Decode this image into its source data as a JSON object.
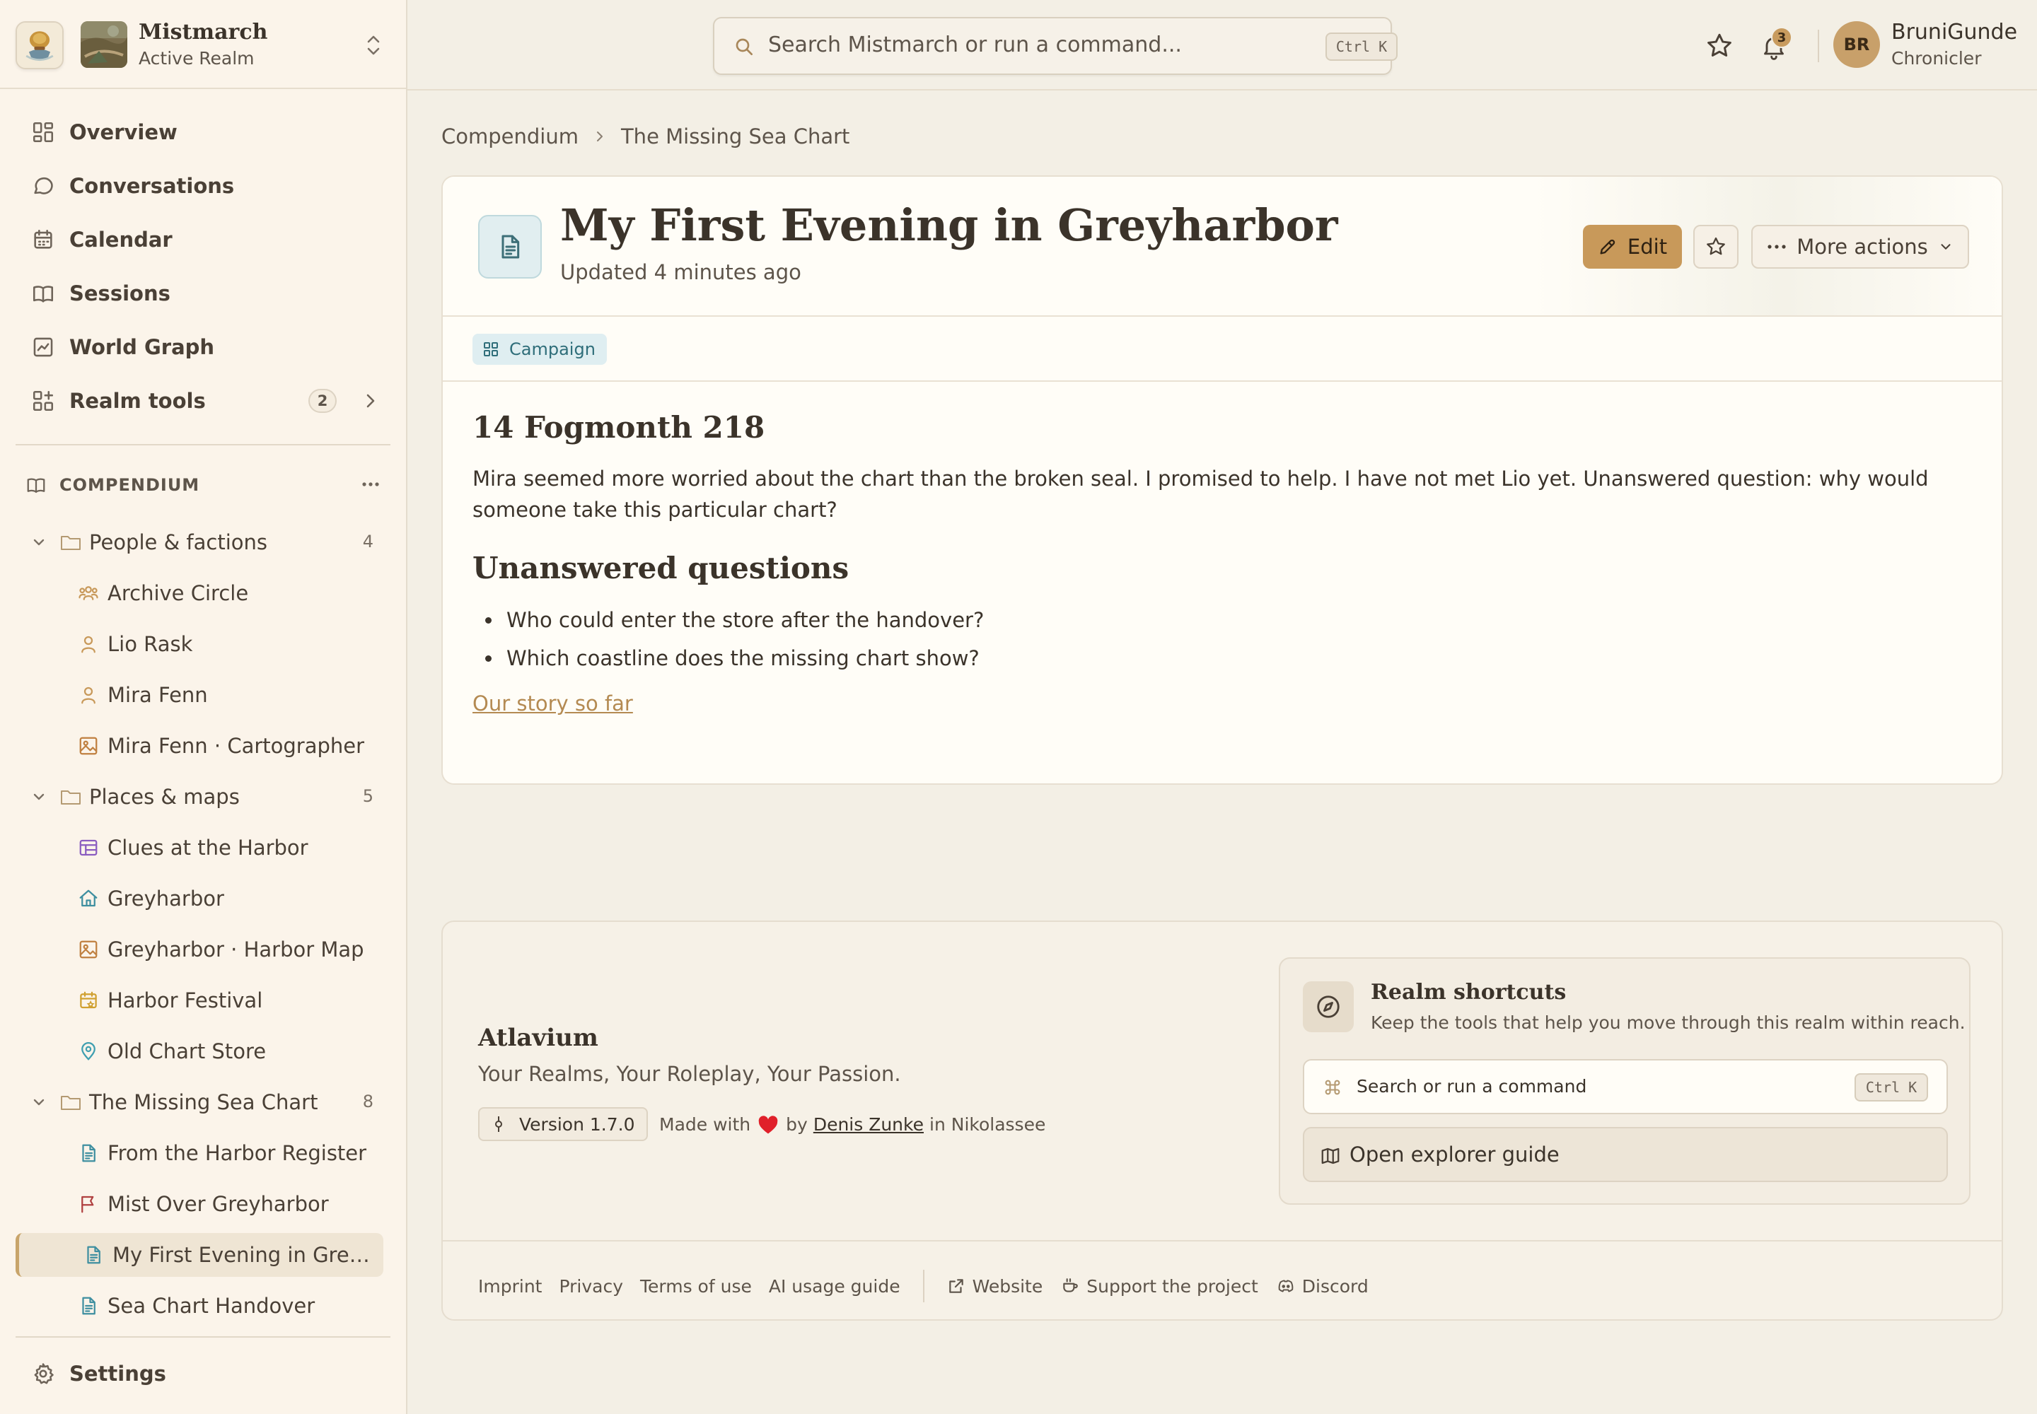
{
  "app": {
    "name": "Mistmarch",
    "realm_status": "Active Realm"
  },
  "nav": {
    "items": [
      {
        "label": "Overview",
        "icon": "dashboard-icon"
      },
      {
        "label": "Conversations",
        "icon": "chat-bubble-icon"
      },
      {
        "label": "Calendar",
        "icon": "calendar-icon"
      },
      {
        "label": "Sessions",
        "icon": "book-open-icon"
      },
      {
        "label": "World Graph",
        "icon": "line-chart-icon"
      },
      {
        "label": "Realm tools",
        "icon": "grid-plus-icon",
        "badge": "2"
      }
    ],
    "settings_label": "Settings"
  },
  "compendium": {
    "title": "COMPENDIUM",
    "folders": [
      {
        "label": "People & factions",
        "count": "4",
        "items": [
          {
            "label": "Archive Circle",
            "icon": "group-icon",
            "color": "#c8995a"
          },
          {
            "label": "Lio Rask",
            "icon": "person-icon",
            "color": "#c8995a"
          },
          {
            "label": "Mira Fenn",
            "icon": "person-icon",
            "color": "#c8995a"
          },
          {
            "label": "Mira Fenn · Cartographer",
            "icon": "image-icon",
            "color": "#c08040"
          }
        ]
      },
      {
        "label": "Places & maps",
        "count": "5",
        "items": [
          {
            "label": "Clues at the Harbor",
            "icon": "table-icon",
            "color": "#8a5cc0"
          },
          {
            "label": "Greyharbor",
            "icon": "home-icon",
            "color": "#3f8fa0"
          },
          {
            "label": "Greyharbor · Harbor Map",
            "icon": "image-icon",
            "color": "#c08040"
          },
          {
            "label": "Harbor Festival",
            "icon": "calendar-event-icon",
            "color": "#d0a030"
          },
          {
            "label": "Old Chart Store",
            "icon": "map-pin-icon",
            "color": "#3f9fb0"
          }
        ]
      },
      {
        "label": "The Missing Sea Chart",
        "count": "8",
        "items": [
          {
            "label": "From the Harbor Register",
            "icon": "document-icon",
            "color": "#3f8fa0"
          },
          {
            "label": "Mist Over Greyharbor",
            "icon": "flag-icon",
            "color": "#b04040"
          },
          {
            "label": "My First Evening in Greyharbor",
            "icon": "document-icon",
            "color": "#3f8fa0",
            "active": true
          },
          {
            "label": "Sea Chart Handover",
            "icon": "document-icon",
            "color": "#3f8fa0"
          }
        ]
      }
    ]
  },
  "search": {
    "placeholder": "Search Mistmarch or run a command...",
    "shortcut": "Ctrl K"
  },
  "notifications": {
    "count": "3"
  },
  "user": {
    "initials": "BR",
    "name": "BruniGunde",
    "role": "Chronicler"
  },
  "breadcrumb": [
    "Compendium",
    "The Missing Sea Chart"
  ],
  "document": {
    "title": "My First Evening in Greyharbor",
    "updated": "Updated 4 minutes ago",
    "edit_label": "Edit",
    "more_label": "More actions",
    "tag": "Campaign",
    "date_heading": "14 Fogmonth 218",
    "paragraph": "Mira seemed more worried about the chart than the broken seal. I promised to help. I have not met Lio yet. Unanswered question: why would someone take this particular chart?",
    "questions_heading": "Unanswered questions",
    "questions": [
      "Who could enter the store after the handover?",
      "Which coastline does the missing chart show?"
    ],
    "link_label": "Our story so far"
  },
  "footer": {
    "brand": "Atlavium",
    "tagline": "Your Realms, Your Roleplay, Your Passion.",
    "version": "Version 1.7.0",
    "made_with": "Made with",
    "by": "by",
    "author": "Denis Zunke",
    "location": "in Nikolassee",
    "shortcuts": {
      "title": "Realm shortcuts",
      "description": "Keep the tools that help you move through this realm within reach.",
      "search_label": "Search or run a command",
      "search_shortcut": "Ctrl K",
      "guide_label": "Open explorer guide"
    },
    "links": [
      "Imprint",
      "Privacy",
      "Terms of use",
      "AI usage guide"
    ],
    "external_links": [
      {
        "label": "Website",
        "icon": "external-link-icon"
      },
      {
        "label": "Support the project",
        "icon": "coffee-icon"
      },
      {
        "label": "Discord",
        "icon": "discord-icon"
      }
    ]
  },
  "colors": {
    "accent": "#c8995a",
    "background": "#f3efe5",
    "sidebar": "#fbf4ea",
    "heart": "#e0202a"
  }
}
